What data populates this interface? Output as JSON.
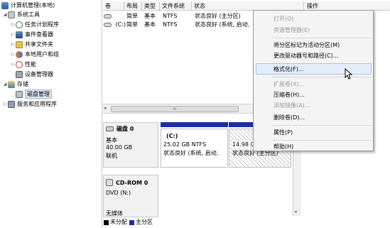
{
  "tree": [
    {
      "label": "计算机管理(本地)",
      "indent": 0,
      "arrow": "",
      "icon": "computer"
    },
    {
      "label": "系统工具",
      "indent": 1,
      "arrow": "◢",
      "icon": "tools"
    },
    {
      "label": "任务计划程序",
      "indent": 2,
      "arrow": "▷",
      "icon": "clock"
    },
    {
      "label": "事件查看器",
      "indent": 2,
      "arrow": "▷",
      "icon": "event"
    },
    {
      "label": "共享文件夹",
      "indent": 2,
      "arrow": "▷",
      "icon": "folder"
    },
    {
      "label": "本地用户和组",
      "indent": 2,
      "arrow": "▷",
      "icon": "users"
    },
    {
      "label": "性能",
      "indent": 2,
      "arrow": "▷",
      "icon": "perf"
    },
    {
      "label": "设备管理器",
      "indent": 2,
      "arrow": "",
      "icon": "device"
    },
    {
      "label": "存储",
      "indent": 1,
      "arrow": "◢",
      "icon": "storage"
    },
    {
      "label": "磁盘管理",
      "indent": 2,
      "arrow": "",
      "icon": "disk",
      "selected": true
    },
    {
      "label": "服务和应用程序",
      "indent": 1,
      "arrow": "▷",
      "icon": "services"
    }
  ],
  "columns": [
    "卷",
    "布局",
    "类型",
    "文件系统",
    "状态"
  ],
  "actions_header": "操作",
  "volumes": [
    {
      "name": "",
      "layout": "简单",
      "type": "基本",
      "fs": "NTFS",
      "status": "状态良好 (主分区)"
    },
    {
      "name": "(C:)",
      "layout": "简单",
      "type": "基本",
      "fs": "NTFS",
      "status": "状态良好 (系统, 启动,"
    }
  ],
  "hscroll_mark": "III",
  "disk0": {
    "title": "磁盘 0",
    "kind": "基本",
    "size": "40.00 GB",
    "state": "联机",
    "part1": {
      "name": "(C:)",
      "size": "25.02 GB NTFS",
      "status": "状态良好 (系统, 启动,"
    },
    "part2": {
      "size": "14.98 G",
      "status": "状态良好 (主分区)"
    }
  },
  "cdrom": {
    "title": "CD-ROM 0",
    "drive": "DVD (N:)",
    "media": "无媒体"
  },
  "legend": [
    {
      "label": "未分配",
      "color": "#000000"
    },
    {
      "label": "主分区",
      "color": "#1c2f9e"
    }
  ],
  "menu": {
    "items": [
      {
        "label": "打开(O)",
        "enabled": false
      },
      {
        "label": "资源管理器(E)",
        "enabled": false
      },
      {
        "label": "将分区标记为活动分区(M)",
        "enabled": true
      },
      {
        "label": "更改驱动器号和路径(C)...",
        "enabled": true
      },
      {
        "label": "格式化(F)...",
        "enabled": true,
        "highlighted": true
      },
      {
        "label": "扩展卷(X)...",
        "enabled": false
      },
      {
        "label": "压缩卷(H)...",
        "enabled": true
      },
      {
        "label": "添加镜像(A)...",
        "enabled": false
      },
      {
        "label": "删除卷(D)...",
        "enabled": true
      },
      {
        "label": "属性(P)",
        "enabled": true
      },
      {
        "label": "帮助(H)",
        "enabled": true
      }
    ]
  },
  "colors": {
    "partition_bar": "#1c2f9e",
    "menu_highlight": "#e3edfa",
    "selection": "#dde8f5"
  }
}
